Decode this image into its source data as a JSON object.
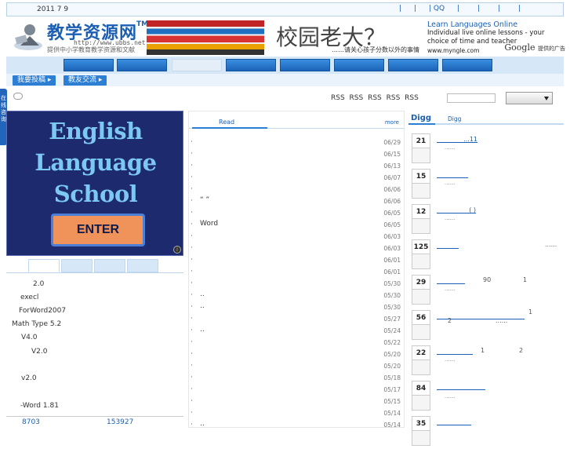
{
  "topbar": {
    "date": "2011 7 9",
    "links": [
      "|",
      "|",
      "| QQ",
      "|",
      "|",
      "|",
      "|"
    ]
  },
  "logo": {
    "title": "教学资源网",
    "tm": "TM",
    "url": "http://www.ubbs.net",
    "subtitle": "提供中小学教育教学资源和文献"
  },
  "banner": {
    "headline": "校园老大？",
    "tagline": "……请关心孩子分数以外的事情"
  },
  "ad": {
    "title": "Learn Languages Online",
    "desc": "Individual live online lessons - your choice of time and teacher",
    "url": "www.myngle.com",
    "google": "Google",
    "google_sub": "提供的广告"
  },
  "subnav": {
    "items": [
      "我要投稿 ▸",
      "教友交流 ▸"
    ]
  },
  "rssbar": {
    "rss": "RSS RSS RSS RSS RSS"
  },
  "sidetab": {
    "label": "在线咨询"
  },
  "english_ad": {
    "lines": [
      "English",
      "Language",
      "School"
    ],
    "enter": "ENTER",
    "info": "i"
  },
  "software": [
    "2.0",
    "execl",
    "ForWord2007",
    "Math Type 5.2",
    "V4.0",
    "V2.0",
    "v2.0",
    "-Word 1.81"
  ],
  "left_footer": {
    "a": "8703",
    "b": "153927"
  },
  "mid": {
    "tab": "Read",
    "more": "more",
    "rows": [
      {
        "text": "",
        "date": "06/29"
      },
      {
        "text": "",
        "date": "06/15"
      },
      {
        "text": "",
        "date": "06/13"
      },
      {
        "text": "",
        "date": "06/07"
      },
      {
        "text": "",
        "date": "06/06"
      },
      {
        "text": "“ ”",
        "date": "06/06"
      },
      {
        "text": "",
        "date": "06/05"
      },
      {
        "text": "Word",
        "date": "06/05"
      },
      {
        "text": "",
        "date": "06/03"
      },
      {
        "text": "",
        "date": "06/03"
      },
      {
        "text": "",
        "date": "06/01"
      },
      {
        "text": "",
        "date": "06/01"
      },
      {
        "text": "",
        "date": "05/30"
      },
      {
        "text": "..",
        "date": "05/30"
      },
      {
        "text": "..",
        "date": "05/30"
      },
      {
        "text": "",
        "date": "05/27"
      },
      {
        "text": "..",
        "date": "05/24"
      },
      {
        "text": "",
        "date": "05/22"
      },
      {
        "text": "",
        "date": "05/20"
      },
      {
        "text": "",
        "date": "05/20"
      },
      {
        "text": "",
        "date": "05/18"
      },
      {
        "text": "",
        "date": "05/17"
      },
      {
        "text": "",
        "date": "05/15"
      },
      {
        "text": "",
        "date": "05/14"
      },
      {
        "text": "..",
        "date": "05/14"
      }
    ]
  },
  "digg": {
    "tab1": "Digg",
    "tab2": "Digg",
    "items": [
      {
        "n": "21",
        "title": "...11",
        "m": "......"
      },
      {
        "n": "15",
        "title": "",
        "m": "......"
      },
      {
        "n": "12",
        "title": "( )",
        "m": "......"
      },
      {
        "n": "125",
        "title": "",
        "extra": "......"
      },
      {
        "n": "29",
        "title": "",
        "a": "90",
        "b": "1",
        "m": "......"
      },
      {
        "n": "56",
        "title": "",
        "a": "1",
        "c": "2",
        "d": "......"
      },
      {
        "n": "22",
        "title": "",
        "a": "1",
        "b": "2",
        "m": "......"
      },
      {
        "n": "84",
        "title": "",
        "m": "......"
      },
      {
        "n": "35",
        "title": ""
      }
    ]
  }
}
